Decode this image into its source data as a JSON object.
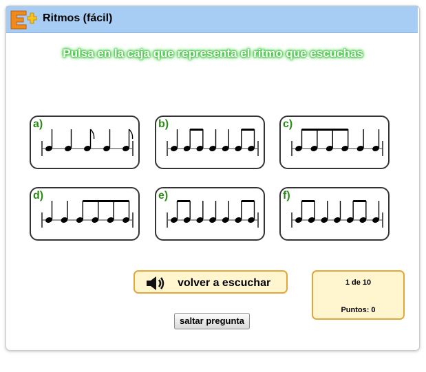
{
  "header": {
    "title": "Ritmos (fácil)",
    "logo_icon": "e-plus-logo-icon",
    "logo_color": "#f08a1c"
  },
  "instruction": "Pulsa en la caja que representa el ritmo que escuchas",
  "options": [
    {
      "letter": "a)",
      "rhythm": [
        "q",
        "q",
        "e",
        "q",
        "e"
      ]
    },
    {
      "letter": "b)",
      "rhythm": [
        "q",
        "ee",
        "q",
        "q",
        "ee"
      ]
    },
    {
      "letter": "c)",
      "rhythm": [
        "eeee",
        "q",
        "q"
      ]
    },
    {
      "letter": "d)",
      "rhythm": [
        "q",
        "q",
        "eeee"
      ]
    },
    {
      "letter": "e)",
      "rhythm": [
        "ee",
        "q",
        "q",
        "q",
        "ee"
      ]
    },
    {
      "letter": "f)",
      "rhythm": [
        "ee",
        "q",
        "q",
        "ee",
        "q"
      ]
    }
  ],
  "replay": {
    "label": "volver a escuchar",
    "icon": "speaker-icon"
  },
  "skip": {
    "label": "saltar pregunta"
  },
  "score": {
    "question": "1 de 10",
    "points": "Puntos: 0"
  },
  "colors": {
    "titlebar": "#a7cdf5",
    "letter": "#2a8b17",
    "accent_border": "#e3a63a",
    "accent_fill": "#fff5cf",
    "instruction_glow": "#2fbf2f"
  }
}
